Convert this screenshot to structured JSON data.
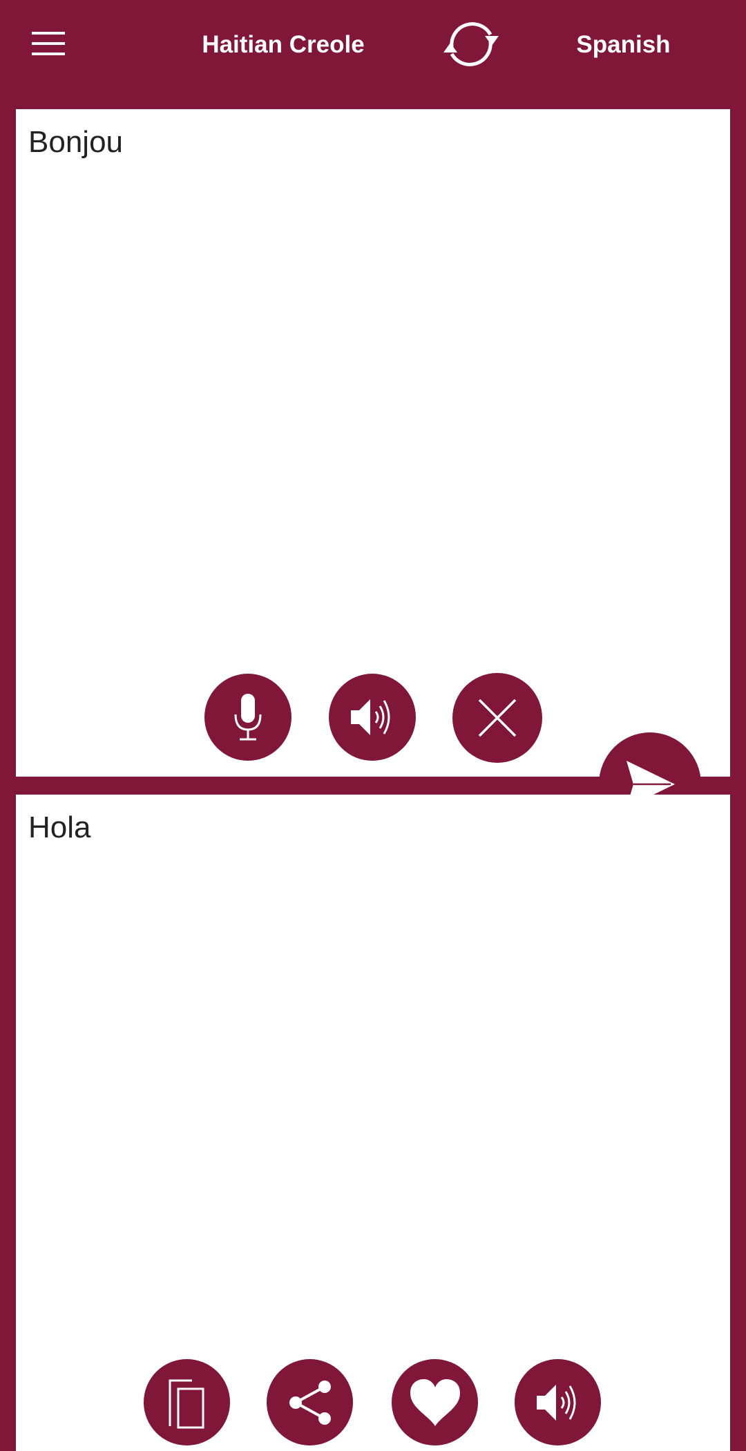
{
  "header": {
    "menu_icon": "hamburger-menu-icon",
    "source_language": "Haitian Creole",
    "swap_icon": "swap-languages-icon",
    "target_language": "Spanish"
  },
  "source_panel": {
    "text": "Bonjou",
    "actions": [
      {
        "name": "microphone",
        "icon": "microphone-icon"
      },
      {
        "name": "speak-source",
        "icon": "speaker-icon"
      },
      {
        "name": "clear",
        "icon": "close-icon"
      }
    ]
  },
  "translate_button": {
    "icon": "send-icon"
  },
  "target_panel": {
    "text": "Hola",
    "actions": [
      {
        "name": "copy",
        "icon": "copy-icon"
      },
      {
        "name": "share",
        "icon": "share-icon"
      },
      {
        "name": "favorite",
        "icon": "heart-icon"
      },
      {
        "name": "speak-target",
        "icon": "speaker-icon"
      }
    ]
  },
  "colors": {
    "primary": "#801638",
    "panel_background": "#ffffff",
    "text": "#222222",
    "icon": "#ffffff"
  }
}
